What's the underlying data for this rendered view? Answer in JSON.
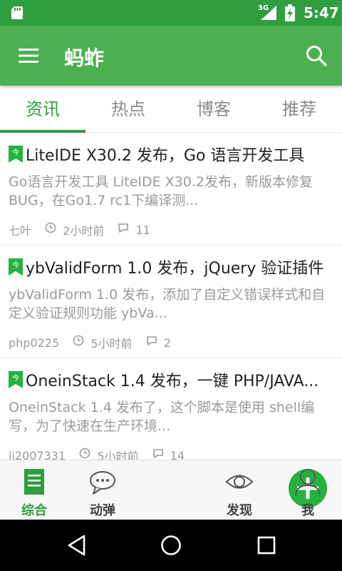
{
  "status_bar": {
    "network": "3G",
    "time": "5:47"
  },
  "app_bar": {
    "title": "蚂蚱"
  },
  "tabs": [
    {
      "label": "资讯",
      "active": true
    },
    {
      "label": "热点",
      "active": false
    },
    {
      "label": "博客",
      "active": false
    },
    {
      "label": "推荐",
      "active": false
    }
  ],
  "articles": [
    {
      "title": "LiteIDE X30.2 发布，Go 语言开发工具",
      "summary": "Go语言开发工具 LiteIDE X30.2发布，新版本修复BUG，在Go1.7 rc1下编译测...",
      "author": "七叶",
      "time": "2小时前",
      "comments": "11"
    },
    {
      "title": "ybValidForm 1.0 发布，jQuery 验证插件",
      "summary": "ybValidForm 1.0 发布，添加了自定义错误样式和自定义验证规则功能 ybVa...",
      "author": "php0225",
      "time": "5小时前",
      "comments": "2"
    },
    {
      "title": "OneinStack 1.4 发布，一键 PHP/JAVA...",
      "summary": "OneinStack 1.4 发布了，这个脚本是使用 shell编写，为了快速在生产环境...",
      "author": "li2007331",
      "time": "5小时前",
      "comments": "14"
    }
  ],
  "bottom_nav": [
    {
      "label": "综合",
      "icon": "document-icon",
      "active": true
    },
    {
      "label": "动弹",
      "icon": "chat-bubble-icon",
      "active": false
    },
    {
      "label": "",
      "icon": "plus-icon",
      "active": false
    },
    {
      "label": "发现",
      "icon": "eye-icon",
      "active": false
    },
    {
      "label": "我",
      "icon": "person-icon",
      "active": false
    }
  ],
  "colors": {
    "primary": "#4caf50",
    "primary_dark": "#2e9e3e",
    "fab": "#24b33f",
    "text_primary": "#222222",
    "text_secondary": "#9a9a9a"
  }
}
